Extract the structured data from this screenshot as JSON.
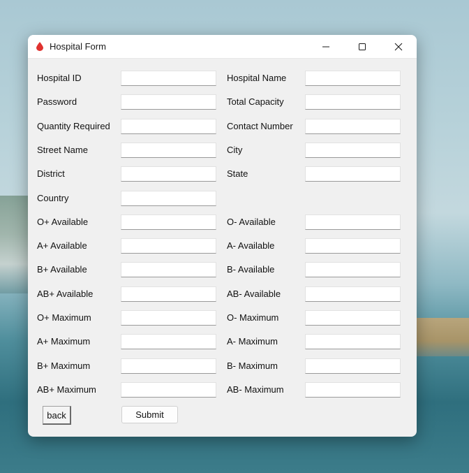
{
  "window": {
    "title": "Hospital Form",
    "minimize_glyph": "—",
    "close_glyph": "✕"
  },
  "form": {
    "rows": [
      {
        "left": {
          "label": "Hospital ID",
          "value": ""
        },
        "right": {
          "label": "Hospital Name",
          "value": ""
        }
      },
      {
        "left": {
          "label": "Password",
          "value": ""
        },
        "right": {
          "label": "Total Capacity",
          "value": ""
        }
      },
      {
        "left": {
          "label": "Quantity Required",
          "value": ""
        },
        "right": {
          "label": "Contact Number",
          "value": ""
        }
      },
      {
        "left": {
          "label": "Street Name",
          "value": ""
        },
        "right": {
          "label": "City",
          "value": ""
        }
      },
      {
        "left": {
          "label": "District",
          "value": ""
        },
        "right": {
          "label": "State",
          "value": ""
        }
      },
      {
        "left": {
          "label": "Country",
          "value": ""
        }
      },
      {
        "left": {
          "label": "O+ Available",
          "value": ""
        },
        "right": {
          "label": "O- Available",
          "value": ""
        }
      },
      {
        "left": {
          "label": "A+ Available",
          "value": ""
        },
        "right": {
          "label": "A- Available",
          "value": ""
        }
      },
      {
        "left": {
          "label": "B+ Available",
          "value": ""
        },
        "right": {
          "label": "B- Available",
          "value": ""
        }
      },
      {
        "left": {
          "label": "AB+ Available",
          "value": ""
        },
        "right": {
          "label": "AB- Available",
          "value": ""
        }
      },
      {
        "left": {
          "label": "O+ Maximum",
          "value": ""
        },
        "right": {
          "label": "O- Maximum",
          "value": ""
        }
      },
      {
        "left": {
          "label": "A+ Maximum",
          "value": ""
        },
        "right": {
          "label": "A- Maximum",
          "value": ""
        }
      },
      {
        "left": {
          "label": "B+ Maximum",
          "value": ""
        },
        "right": {
          "label": "B- Maximum",
          "value": ""
        }
      },
      {
        "left": {
          "label": "AB+ Maximum",
          "value": ""
        },
        "right": {
          "label": "AB- Maximum",
          "value": ""
        }
      }
    ]
  },
  "buttons": {
    "back_label": "back",
    "submit_label": "Submit"
  },
  "colors": {
    "app_icon": "#e0322f",
    "window_bg": "#f0f0f0"
  }
}
